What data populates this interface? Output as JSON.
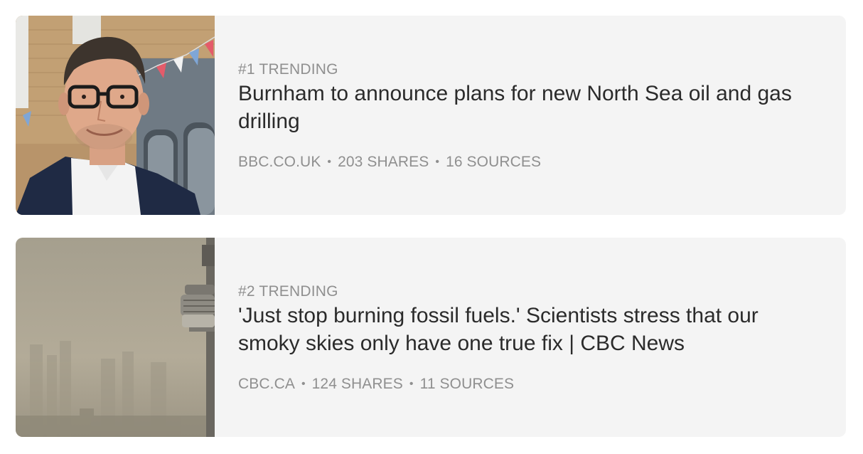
{
  "articles": [
    {
      "rank": "#1 TRENDING",
      "headline": "Burnham to announce plans for new North Sea oil and gas drilling",
      "source": "BBC.CO.UK",
      "shares": "203 SHARES",
      "sources": "16 SOURCES",
      "thumbnail": "portrait-photo"
    },
    {
      "rank": "#2 TRENDING",
      "headline": "'Just stop burning fossil fuels.' Scientists stress that our smoky skies only have one true fix | CBC News",
      "source": "CBC.CA",
      "shares": "124 SHARES",
      "sources": "11 SOURCES",
      "thumbnail": "smoky-skyline-photo"
    }
  ],
  "separator": "•",
  "colors": {
    "card_background": "#f4f4f4",
    "headline": "#2b2b2b",
    "muted": "#8f8f8f"
  }
}
